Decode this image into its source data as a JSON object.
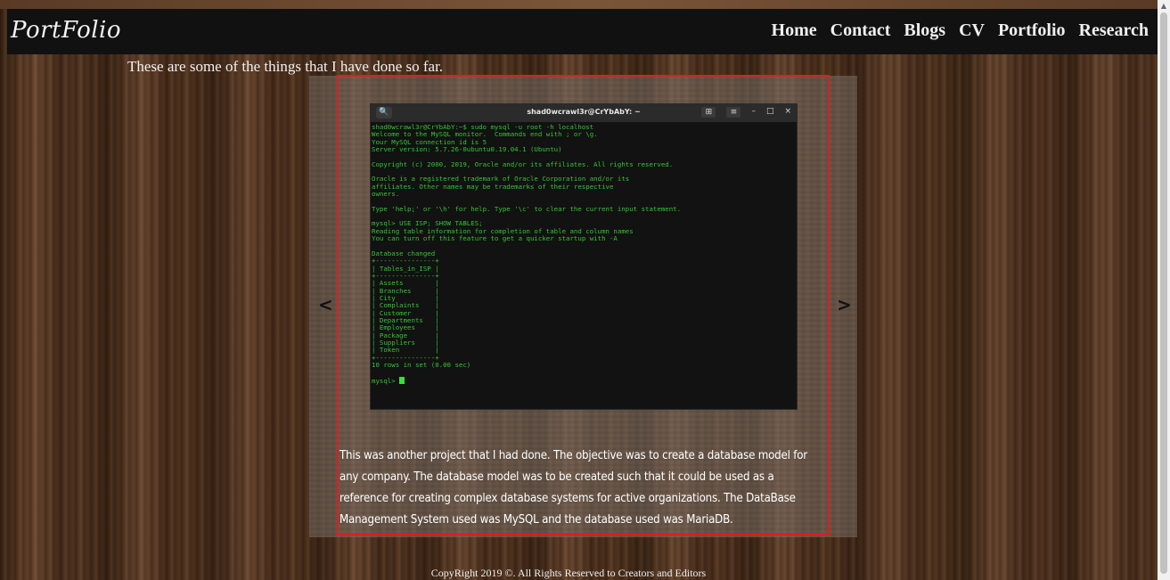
{
  "brand": {
    "logo": "PortFolio"
  },
  "nav": {
    "items": [
      {
        "label": "Home"
      },
      {
        "label": "Contact"
      },
      {
        "label": "Blogs"
      },
      {
        "label": "CV"
      },
      {
        "label": "Portfolio"
      },
      {
        "label": "Research"
      }
    ]
  },
  "intro": "These are some of the things that I have done so far.",
  "carousel": {
    "prev_label": "<",
    "next_label": ">",
    "terminal": {
      "title": "shad0wcrawl3r@CrYbAbY: ~",
      "search_glyph": "🔍",
      "controls": [
        "⊞",
        "≡",
        "–",
        "□",
        "×"
      ],
      "lines": [
        "shad0wcrawl3r@CrYbAbY:~$ sudo mysql -u root -h localhost",
        "Welcome to the MySQL monitor.  Commands end with ; or \\g.",
        "Your MySQL connection id is 5",
        "Server version: 5.7.26-0ubuntu0.19.04.1 (Ubuntu)",
        "",
        "Copyright (c) 2000, 2019, Oracle and/or its affiliates. All rights reserved.",
        "",
        "Oracle is a registered trademark of Oracle Corporation and/or its",
        "affiliates. Other names may be trademarks of their respective",
        "owners.",
        "",
        "Type 'help;' or '\\h' for help. Type '\\c' to clear the current input statement.",
        "",
        "mysql> USE ISP; SHOW TABLES;",
        "Reading table information for completion of table and column names",
        "You can turn off this feature to get a quicker startup with -A",
        "",
        "Database changed",
        "+---------------+",
        "| Tables_in_ISP |",
        "+---------------+",
        "| Assets        |",
        "| Branches      |",
        "| City          |",
        "| Complaints    |",
        "| Customer      |",
        "| Departments   |",
        "| Employees     |",
        "| Package       |",
        "| Suppliers     |",
        "| Token         |",
        "+---------------+",
        "10 rows in set (0.00 sec)",
        ""
      ],
      "prompt": "mysql> "
    },
    "description": "This was another project that I had done. The objective was to create a database model for any company. The database model was to be created such that it could be used as a reference for creating complex database systems for active organizations. The DataBase Management System used was MySQL and the database used was MariaDB."
  },
  "footer": "CopyRight 2019 ©. All Rights Reserved to Creators and Editors",
  "scrollbar": {
    "up_glyph": "▲"
  }
}
